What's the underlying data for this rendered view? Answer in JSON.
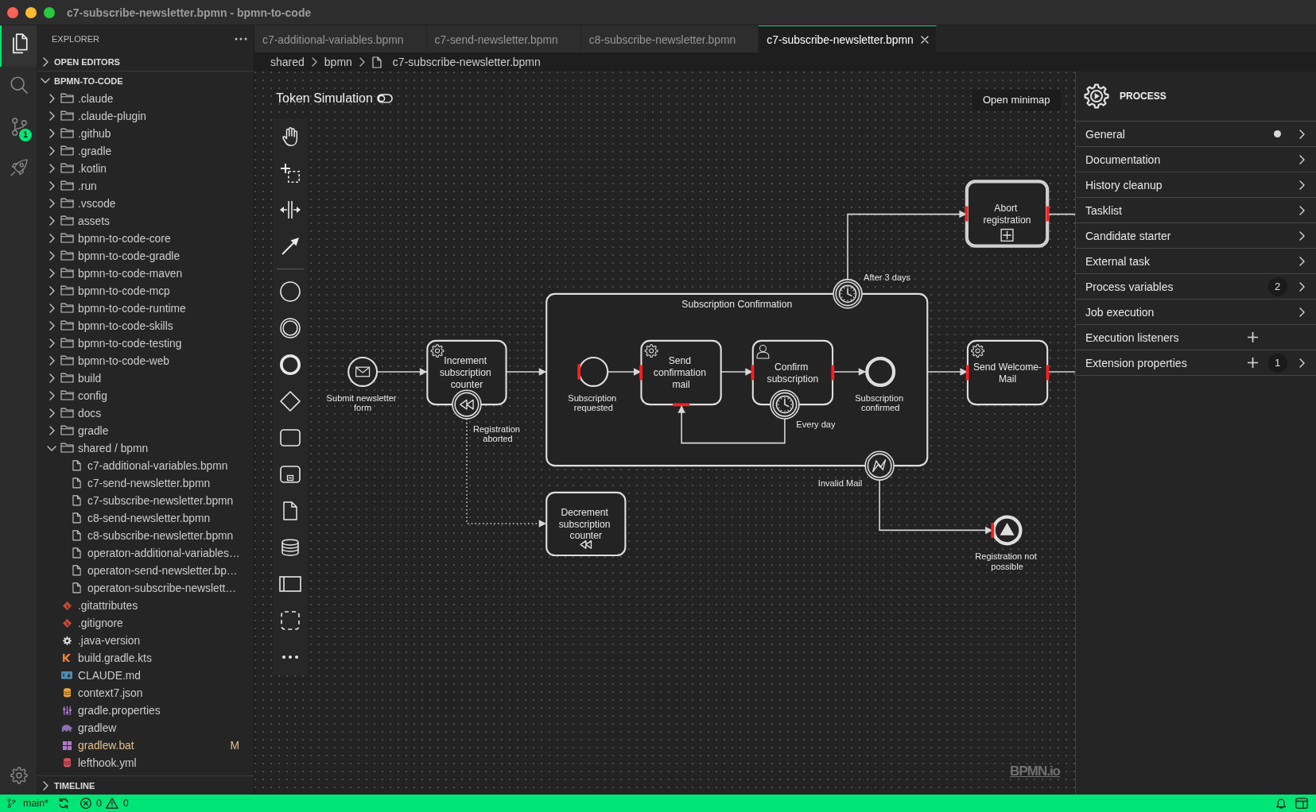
{
  "window": {
    "title": "c7-subscribe-newsletter.bpmn - bpmn-to-code"
  },
  "activity_bar": {
    "items": [
      {
        "kind": "explorer",
        "selected": true
      },
      {
        "kind": "search",
        "selected": false
      },
      {
        "kind": "source-control",
        "selected": false,
        "badge": "1"
      },
      {
        "kind": "extension",
        "selected": false
      }
    ]
  },
  "sidebar": {
    "title": "EXPLORER",
    "sections": [
      {
        "title": "OPEN EDITORS",
        "expanded": false
      },
      {
        "title": "BPMN-TO-CODE",
        "expanded": true,
        "items": [
          {
            "name": ".claude",
            "kind": "folder",
            "expanded": false
          },
          {
            "name": ".claude-plugin",
            "kind": "folder",
            "expanded": false
          },
          {
            "name": ".github",
            "kind": "folder",
            "expanded": false
          },
          {
            "name": ".gradle",
            "kind": "folder",
            "expanded": false
          },
          {
            "name": ".kotlin",
            "kind": "folder",
            "expanded": false
          },
          {
            "name": ".run",
            "kind": "folder",
            "expanded": false
          },
          {
            "name": ".vscode",
            "kind": "folder",
            "expanded": false
          },
          {
            "name": "assets",
            "kind": "folder",
            "expanded": false
          },
          {
            "name": "bpmn-to-code-core",
            "kind": "folder",
            "expanded": false
          },
          {
            "name": "bpmn-to-code-gradle",
            "kind": "folder",
            "expanded": false
          },
          {
            "name": "bpmn-to-code-maven",
            "kind": "folder",
            "expanded": false
          },
          {
            "name": "bpmn-to-code-mcp",
            "kind": "folder",
            "expanded": false
          },
          {
            "name": "bpmn-to-code-runtime",
            "kind": "folder",
            "expanded": false
          },
          {
            "name": "bpmn-to-code-skills",
            "kind": "folder",
            "expanded": false
          },
          {
            "name": "bpmn-to-code-testing",
            "kind": "folder",
            "expanded": false
          },
          {
            "name": "bpmn-to-code-web",
            "kind": "folder",
            "expanded": false
          },
          {
            "name": "build",
            "kind": "folder",
            "expanded": false
          },
          {
            "name": "config",
            "kind": "folder",
            "expanded": false
          },
          {
            "name": "docs",
            "kind": "folder",
            "expanded": false
          },
          {
            "name": "gradle",
            "kind": "folder",
            "expanded": false
          },
          {
            "name": "shared / bpmn",
            "kind": "folder",
            "expanded": true,
            "children": [
              {
                "name": "c7-additional-variables.bpmn",
                "kind": "file"
              },
              {
                "name": "c7-send-newsletter.bpmn",
                "kind": "file"
              },
              {
                "name": "c7-subscribe-newsletter.bpmn",
                "kind": "file"
              },
              {
                "name": "c8-send-newsletter.bpmn",
                "kind": "file"
              },
              {
                "name": "c8-subscribe-newsletter.bpmn",
                "kind": "file"
              },
              {
                "name": "operaton-additional-variables…",
                "kind": "file"
              },
              {
                "name": "operaton-send-newsletter.bp…",
                "kind": "file"
              },
              {
                "name": "operaton-subscribe-newslett…",
                "kind": "file"
              }
            ]
          },
          {
            "name": ".gitattributes",
            "kind": "git"
          },
          {
            "name": ".gitignore",
            "kind": "git"
          },
          {
            "name": ".java-version",
            "kind": "settings"
          },
          {
            "name": "build.gradle.kts",
            "kind": "kotlin"
          },
          {
            "name": "CLAUDE.md",
            "kind": "markdown"
          },
          {
            "name": "context7.json",
            "kind": "json"
          },
          {
            "name": "gradle.properties",
            "kind": "properties"
          },
          {
            "name": "gradlew",
            "kind": "gradle"
          },
          {
            "name": "gradlew.bat",
            "kind": "batch",
            "status": "M"
          },
          {
            "name": "lefthook.yml",
            "kind": "yaml"
          }
        ]
      },
      {
        "title": "TIMELINE",
        "expanded": false
      }
    ]
  },
  "tabs": [
    {
      "label": "c7-additional-variables.bpmn",
      "selected": false
    },
    {
      "label": "c7-send-newsletter.bpmn",
      "selected": false
    },
    {
      "label": "c8-subscribe-newsletter.bpmn",
      "selected": false
    },
    {
      "label": "c7-subscribe-newsletter.bpmn",
      "selected": true
    }
  ],
  "breadcrumb": [
    {
      "label": "shared",
      "kind": "folder"
    },
    {
      "label": "bpmn",
      "kind": "folder"
    },
    {
      "label": "c7-subscribe-newsletter.bpmn",
      "kind": "file"
    }
  ],
  "canvas": {
    "token_simulation": {
      "label": "Token Simulation",
      "on": false
    },
    "minimap_button": "Open minimap",
    "diagram": {
      "elements": [
        {
          "kind": "call-activity",
          "label": "Abort registration",
          "marker_left": true,
          "marker_right": true,
          "marker_bottom": false
        },
        {
          "kind": "timer-boundary-event",
          "label": "After 3 days"
        },
        {
          "kind": "subprocess",
          "label": "Subscription Confirmation"
        },
        {
          "kind": "message-start-event",
          "label": "Submit newsletter form"
        },
        {
          "kind": "service-task",
          "label": "Increment subscription counter"
        },
        {
          "kind": "compensation-boundary-event",
          "label": "Registration aborted"
        },
        {
          "kind": "start-event",
          "label": "Subscription requested",
          "marker_left": true,
          "marker_right": false,
          "marker_bottom": false
        },
        {
          "kind": "service-task",
          "label": "Send confirmation mail",
          "marker_left": true,
          "marker_right": false,
          "marker_bottom": true
        },
        {
          "kind": "user-task",
          "label": "Confirm subscription",
          "marker_left": true,
          "marker_right": true,
          "marker_bottom": false
        },
        {
          "kind": "timer-boundary-event",
          "label": "Every day"
        },
        {
          "kind": "end-event",
          "label": "Subscription confirmed"
        },
        {
          "kind": "service-task",
          "label": "Send Welcome-Mail",
          "marker_left": true,
          "marker_right": true,
          "marker_bottom": false
        },
        {
          "kind": "error-boundary-event",
          "label": "Invalid Mail"
        },
        {
          "kind": "compensation-task",
          "label": "Decrement subscription counter"
        },
        {
          "kind": "signal-end-event",
          "label": "Registration not possible",
          "marker_left": true,
          "marker_right": false,
          "marker_bottom": false
        }
      ]
    },
    "logo": "BPMN.io"
  },
  "properties_panel": {
    "title": "PROCESS",
    "groups": [
      {
        "label": "General",
        "dot": true,
        "add": false,
        "expandable": true
      },
      {
        "label": "Documentation",
        "dot": false,
        "add": false,
        "expandable": true
      },
      {
        "label": "History cleanup",
        "dot": false,
        "add": false,
        "expandable": true
      },
      {
        "label": "Tasklist",
        "dot": false,
        "add": false,
        "expandable": true
      },
      {
        "label": "Candidate starter",
        "dot": false,
        "add": false,
        "expandable": true
      },
      {
        "label": "External task",
        "dot": false,
        "add": false,
        "expandable": true
      },
      {
        "label": "Process variables",
        "dot": false,
        "add": false,
        "expandable": true,
        "count": "2"
      },
      {
        "label": "Job execution",
        "dot": false,
        "add": false,
        "expandable": true
      },
      {
        "label": "Execution listeners",
        "dot": false,
        "add": true,
        "expandable": false
      },
      {
        "label": "Extension properties",
        "dot": false,
        "add": true,
        "expandable": true,
        "count": "1"
      }
    ]
  },
  "status_bar": {
    "branch": "main*",
    "errors": "0",
    "warnings": "0"
  }
}
